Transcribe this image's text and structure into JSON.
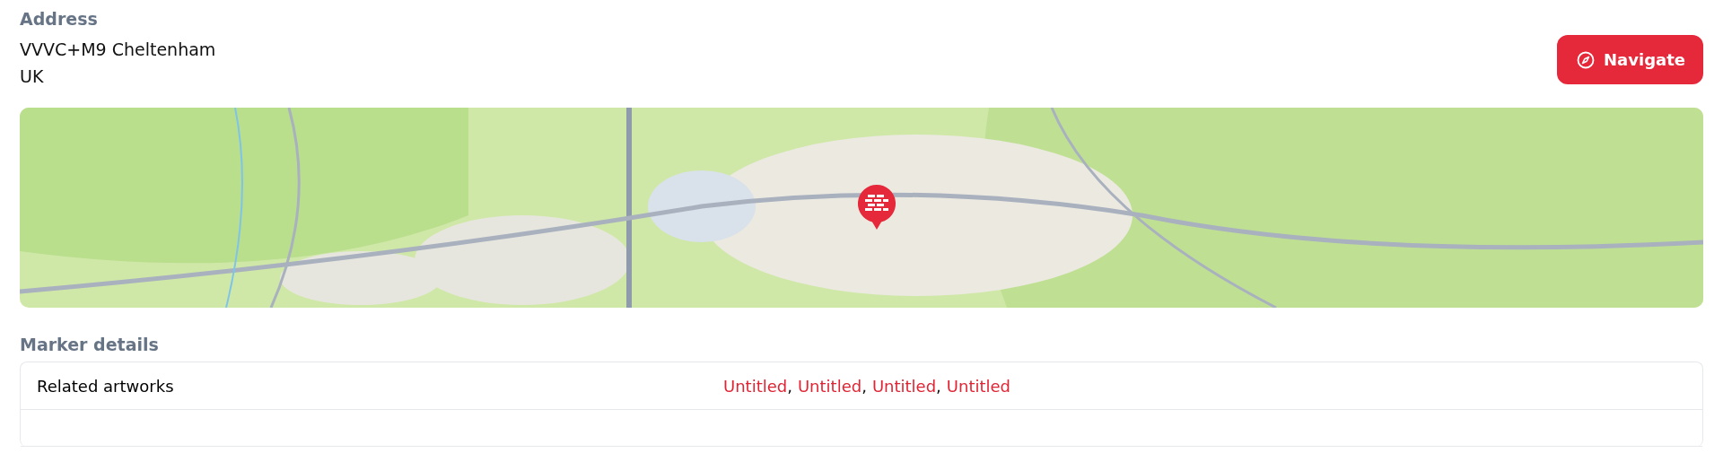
{
  "address": {
    "label": "Address",
    "lines": [
      "VVVC+M9 Cheltenham",
      "UK"
    ]
  },
  "navigate_button": {
    "label": "Navigate"
  },
  "marker_details": {
    "title": "Marker details",
    "rows": [
      {
        "label": "Related artworks",
        "links": [
          {
            "text": "Untitled",
            "separator": ","
          },
          {
            "text": "Untitled",
            "separator": ","
          },
          {
            "text": "Untitled",
            "separator": ","
          },
          {
            "text": "Untitled"
          }
        ]
      }
    ]
  }
}
